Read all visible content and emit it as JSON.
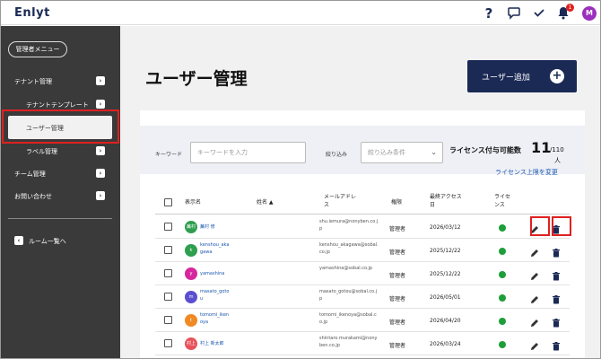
{
  "app": {
    "logo": "Enlyt"
  },
  "topbar": {
    "help_icon": "question-icon",
    "chat_icon": "chat-bubble-icon",
    "check_icon": "checkmark-icon",
    "bell_icon": "bell-icon",
    "notification_count": "1",
    "avatar_initial": "M"
  },
  "sidebar": {
    "menu_button": "管理者メニュー",
    "items": {
      "tenant": "テナント管理",
      "tenant_template": "テナントテンプレート",
      "user": "ユーザー管理",
      "label": "ラベル管理",
      "team": "チーム管理",
      "contact": "お問い合わせ"
    },
    "back": "ルーム一覧へ"
  },
  "page": {
    "title": "ユーザー管理",
    "add_button": "ユーザー追加"
  },
  "filter": {
    "keyword_label": "キーワード",
    "keyword_placeholder": "キーワードを入力",
    "narrow_label": "絞り込み",
    "narrow_placeholder": "絞り込み条件"
  },
  "license": {
    "label": "ライセンス付与可能数",
    "available": "11",
    "total": "/110",
    "unit": "人",
    "change_link": "ライセンス上限を変更"
  },
  "table": {
    "headers": {
      "display_name": "表示名",
      "name": "姓名 ▲",
      "email_line1": "メールアドレ",
      "email_line2": "ス",
      "auth": "権限",
      "last_access_line1": "最終アクセス",
      "last_access_line2": "日",
      "license_line1": "ライセ",
      "license_line2": "ンス"
    },
    "rows": [
      {
        "avatar": "蕪村",
        "display_name": "蕪村 修",
        "email": "shu.iemura@nonyben.co.jp",
        "auth": "管理者",
        "date": "2026/03/12",
        "color": "#2e9e4f"
      },
      {
        "avatar": "k",
        "display_name": "kenshou_akagawa",
        "email": "kenshou_akagawa@sobal.co.jp",
        "auth": "管理者",
        "date": "2025/12/22",
        "color": "#2e9e4f"
      },
      {
        "avatar": "y",
        "display_name": "yamashina",
        "email": "yamashina@sobal.co.jp",
        "auth": "管理者",
        "date": "2025/12/22",
        "color": "#d6269e"
      },
      {
        "avatar": "m",
        "display_name": "masato_gotou",
        "email": "masato_gotou@sobal.co.jp",
        "auth": "管理者",
        "date": "2026/05/01",
        "color": "#5b4fd0"
      },
      {
        "avatar": "t",
        "display_name": "tomomi_ikenoya",
        "email": "tomomi_ikenoya@sobal.co.jp",
        "auth": "管理者",
        "date": "2026/04/20",
        "color": "#f08a24"
      },
      {
        "avatar": "村上",
        "display_name": "村上 新太郎",
        "email": "shintaro.murakami@nonyben.co.jp",
        "auth": "管理者",
        "date": "2026/03/24",
        "color": "#e8525a"
      }
    ]
  }
}
